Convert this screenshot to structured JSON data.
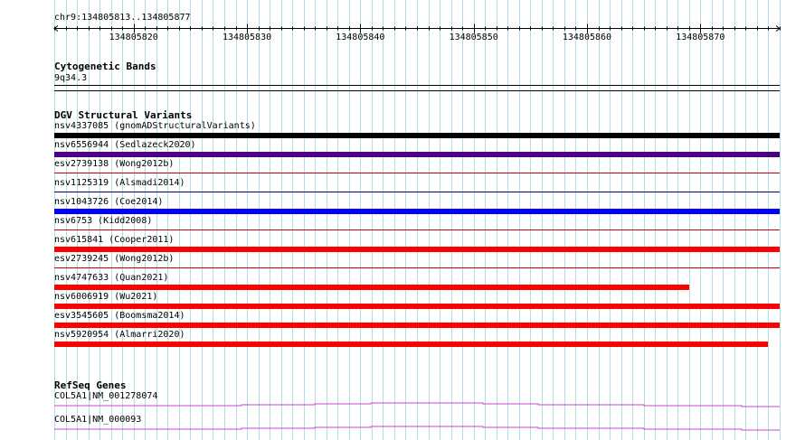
{
  "ruler": {
    "region": "chr9:134805813..134805877",
    "start": 134805813,
    "end": 134805877,
    "ticks": [
      134805820,
      134805830,
      134805840,
      134805850,
      134805860,
      134805870
    ]
  },
  "cyto": {
    "title": "Cytogenetic Bands",
    "band": "9q34.3"
  },
  "dgv": {
    "title": "DGV Structural Variants",
    "variants": [
      {
        "label": "nsv4337085 (gnomADStructuralVariants)",
        "color": "#000000",
        "style": "thick",
        "bar_end": 134805877
      },
      {
        "label": "nsv6556944 (Sedlazeck2020)",
        "color": "#4b0082",
        "style": "thick",
        "bar_end": 134805877
      },
      {
        "label": "esv2739138 (Wong2012b)",
        "color": "#cc0000",
        "style": "thin",
        "bar_end": 134805877
      },
      {
        "label": "nsv1125319 (Alsmadi2014)",
        "color": "#000080",
        "style": "thin",
        "bar_end": 134805877
      },
      {
        "label": "nsv1043726 (Coe2014)",
        "color": "#0000ff",
        "style": "thick",
        "bar_end": 134805877
      },
      {
        "label": "nsv6753 (Kidd2008)",
        "color": "#cc0000",
        "style": "thin",
        "bar_end": 134805877
      },
      {
        "label": "nsv615841 (Cooper2011)",
        "color": "#ff0000",
        "style": "thick",
        "bar_end": 134805877
      },
      {
        "label": "esv2739245 (Wong2012b)",
        "color": "#cc0000",
        "style": "thin",
        "bar_end": 134805877
      },
      {
        "label": "nsv4747633 (Quan2021)",
        "color": "#ff0000",
        "style": "thick",
        "bar_end": 134805869
      },
      {
        "label": "nsv6006919 (Wu2021)",
        "color": "#ff0000",
        "style": "thick",
        "bar_end": 134805877
      },
      {
        "label": "esv3545605 (Boomsma2014)",
        "color": "#ff0000",
        "style": "thick",
        "bar_end": 134805877
      },
      {
        "label": "nsv5920954 (Almarri2020)",
        "color": "#ff0000",
        "style": "thick",
        "bar_end": 134805876
      }
    ]
  },
  "refseq": {
    "title": "RefSeq Genes",
    "genes": [
      {
        "label": "COL5A1|NM_001278074",
        "color": "#cc44cc"
      },
      {
        "label": "COL5A1|NM_000093",
        "color": "#cc44cc"
      }
    ]
  },
  "colors": {
    "grid": "#b0dde6",
    "ruler": "#000000",
    "separator": "#000000"
  }
}
